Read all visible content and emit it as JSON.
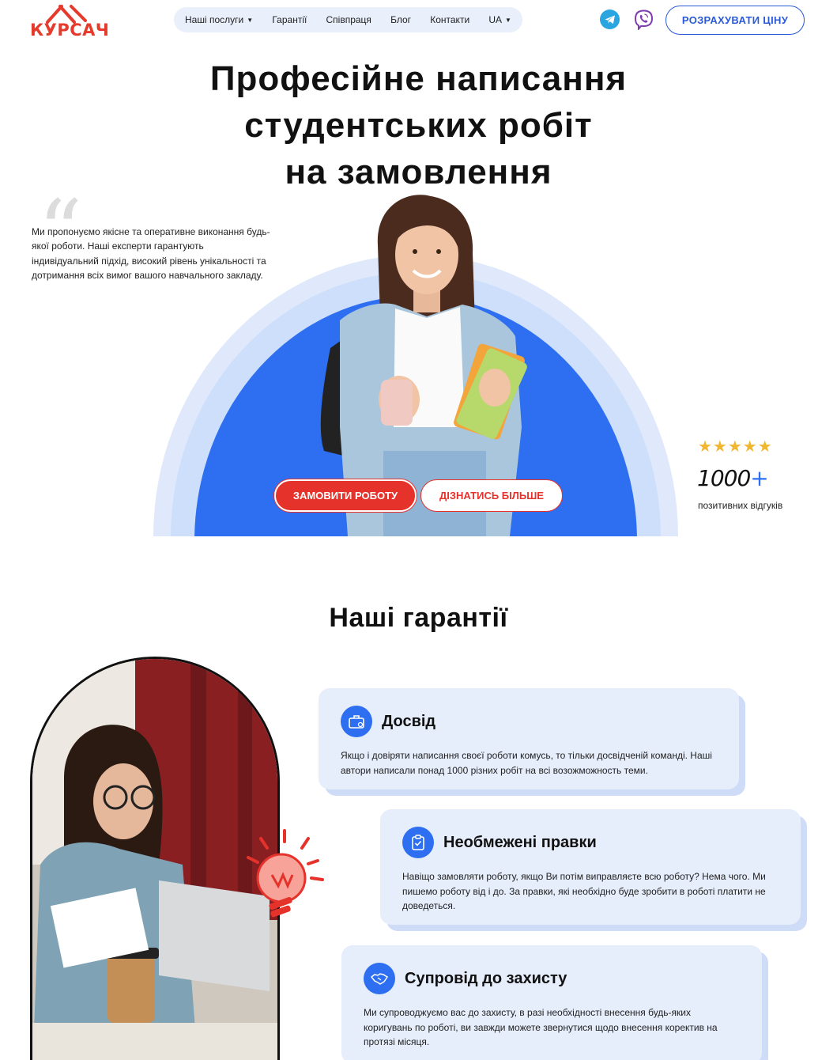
{
  "header": {
    "logo_text": "КУРСАЧ",
    "nav": [
      {
        "label": "Наші послуги",
        "has_caret": true
      },
      {
        "label": "Гарантії",
        "has_caret": false
      },
      {
        "label": "Співпраця",
        "has_caret": false
      },
      {
        "label": "Блог",
        "has_caret": false
      },
      {
        "label": "Контакти",
        "has_caret": false
      },
      {
        "label": "UA",
        "has_caret": true
      }
    ],
    "social_icons": [
      "telegram-icon",
      "viber-icon"
    ],
    "cta_label": "РОЗРАХУВАТИ ЦІНУ"
  },
  "hero": {
    "title_lines": [
      "Професійне написання",
      "студентських робіт",
      "на замовлення"
    ],
    "description": "Ми пропонуємо якісне та оперативне виконання будь-якої роботи. Наші експерти гарантують індивідуальний підхід, високий рівень унікальності та дотримання всіх вимог вашого навчального закладу.",
    "btn_order": "ЗАМОВИТИ РОБОТУ",
    "btn_more": "ДІЗНАТИСЬ БІЛЬШЕ",
    "rating_stars": 5,
    "reviews_count": "1000",
    "reviews_plus": "+",
    "reviews_label": "позитивних відгуків"
  },
  "guarantees": {
    "title": "Наші гарантії",
    "items": [
      {
        "title": "Досвід",
        "text": "Якщо і довіряти написання своєї роботи комусь, то тільки досвідченій команді. Наші автори написали понад 1000 різних робіт на всі возожможность теми.",
        "icon": "briefcase-icon"
      },
      {
        "title": "Необмежені правки",
        "text": "Навіщо замовляти роботу, якщо Ви потім виправляєте всю роботу? Нема чого. Ми пишемо роботу від і до. За правки, які необхідно буде зробити в роботі платити не доведеться.",
        "icon": "checklist-icon"
      },
      {
        "title": "Супровід до захисту",
        "text": "Ми супроводжуємо вас до захисту, в разі необхідності внесення будь-яких коригувань по роботі, ви завжди можете звернутися щодо внесення коректив на протязі місяця.",
        "icon": "handshake-icon"
      }
    ]
  },
  "colors": {
    "brand_red": "#e5322b",
    "brand_blue": "#2d6ff0",
    "card_bg": "#e6edfb",
    "star": "#f0b72f"
  }
}
